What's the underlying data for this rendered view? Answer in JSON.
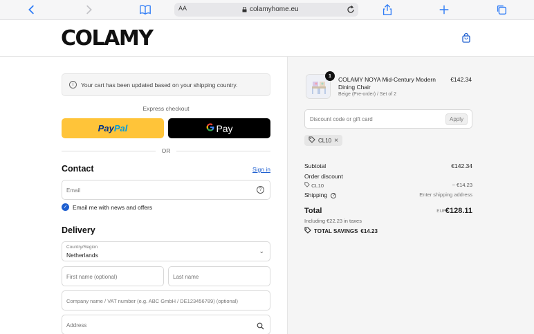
{
  "browser": {
    "aa_label": "AA",
    "url": "colamyhome.eu"
  },
  "header": {
    "logo": "COLAMY"
  },
  "checkout": {
    "notice": "Your cart has been updated based on your shipping country.",
    "express_label": "Express checkout",
    "paypal_label_1": "Pay",
    "paypal_label_2": "Pal",
    "gpay_label": "Pay",
    "or_label": "OR",
    "contact_heading": "Contact",
    "signin_label": "Sign in",
    "email_placeholder": "Email",
    "email_optin_label": "Email me with news and offers",
    "email_optin_checked": true,
    "delivery_heading": "Delivery",
    "country_label": "Country/Region",
    "country_value": "Netherlands",
    "first_name_placeholder": "First name (optional)",
    "last_name_placeholder": "Last name",
    "company_placeholder": "Company name / VAT number (e.g. ABC GmbH / DE123456789) (optional)",
    "address_placeholder": "Address"
  },
  "summary": {
    "item": {
      "quantity": "1",
      "name": "COLAMY NOYA Mid-Century Modern Dining Chair",
      "variant": "Beige (Pre-order) / Set of 2",
      "price": "€142.34"
    },
    "discount_placeholder": "Discount code or gift card",
    "apply_label": "Apply",
    "applied_code": "CL10",
    "subtotal_label": "Subtotal",
    "subtotal_value": "€142.34",
    "order_discount_label": "Order discount",
    "discount_code_label": "CL10",
    "discount_value": "− €14.23",
    "shipping_label": "Shipping",
    "shipping_value": "Enter shipping address",
    "total_label": "Total",
    "total_currency": "EUR",
    "total_value": "€128.11",
    "taxes_note": "Including €22.23 in taxes",
    "savings_label": "TOTAL SAVINGS",
    "savings_value": "€14.23"
  },
  "colors": {
    "accent": "#1e5fd0",
    "paypal_yellow": "#ffc439",
    "gpay_black": "#000000",
    "summary_bg": "#f5f5f5"
  }
}
